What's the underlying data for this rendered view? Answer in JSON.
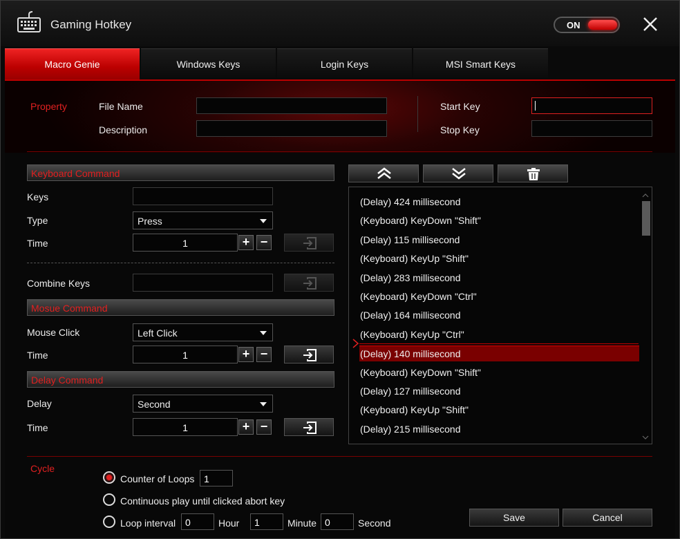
{
  "app": {
    "title": "Gaming Hotkey",
    "power": "ON"
  },
  "tabs": [
    {
      "label": "Macro Genie"
    },
    {
      "label": "Windows Keys"
    },
    {
      "label": "Login Keys"
    },
    {
      "label": "MSI Smart Keys"
    }
  ],
  "property": {
    "heading": "Property",
    "file_name_label": "File Name",
    "file_name_value": "",
    "description_label": "Description",
    "description_value": "",
    "start_key_label": "Start Key",
    "start_key_value": "",
    "stop_key_label": "Stop Key",
    "stop_key_value": ""
  },
  "keyboard": {
    "heading": "Keyboard Command",
    "keys_label": "Keys",
    "keys_value": "",
    "type_label": "Type",
    "type_value": "Press",
    "time_label": "Time",
    "time_value": "1",
    "combine_label": "Combine Keys",
    "combine_value": ""
  },
  "mouse": {
    "heading": "Mosue Command",
    "click_label": "Mouse Click",
    "click_value": "Left Click",
    "time_label": "Time",
    "time_value": "1"
  },
  "delay": {
    "heading": "Delay Command",
    "delay_label": "Delay",
    "delay_value": "Second",
    "time_label": "Time",
    "time_value": "1"
  },
  "stepper": {
    "plus": "+",
    "minus": "−"
  },
  "macro_list": {
    "selected_index": 8,
    "items": [
      "(Delay) 424 millisecond",
      "(Keyboard) KeyDown \"Shift\"",
      "(Delay) 115 millisecond",
      "(Keyboard) KeyUp \"Shift\"",
      "(Delay) 283 millisecond",
      "(Keyboard) KeyDown \"Ctrl\"",
      "(Delay) 164 millisecond",
      "(Keyboard) KeyUp \"Ctrl\"",
      "(Delay) 140 millisecond",
      "(Keyboard) KeyDown \"Shift\"",
      "(Delay) 127 millisecond",
      "(Keyboard) KeyUp \"Shift\"",
      "(Delay) 215 millisecond"
    ]
  },
  "cycle": {
    "heading": "Cycle",
    "counter_label": "Counter of Loops",
    "counter_value": "1",
    "continuous_label": "Continuous play until clicked abort key",
    "interval_label": "Loop interval",
    "hour_value": "0",
    "hour_label": "Hour",
    "minute_value": "1",
    "minute_label": "Minute",
    "second_value": "0",
    "second_label": "Second"
  },
  "actions": {
    "save": "Save",
    "cancel": "Cancel"
  },
  "colors": {
    "accent": "#e02020",
    "selection": "#7a0000"
  }
}
